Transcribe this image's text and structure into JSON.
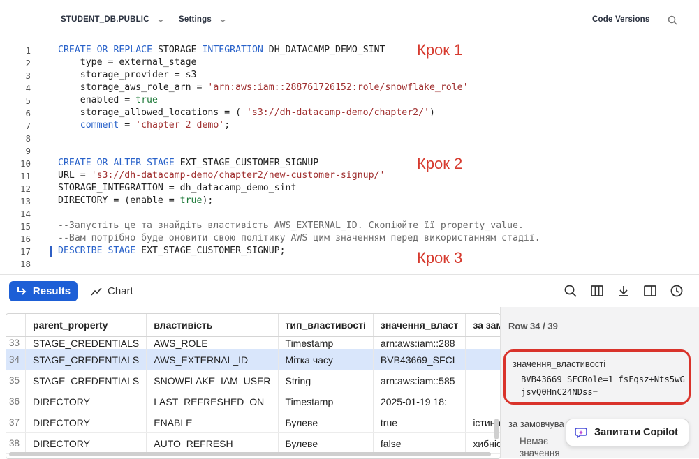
{
  "topbar": {
    "database": "STUDENT_DB.PUBLIC",
    "settings": "Settings",
    "code_versions": "Code Versions"
  },
  "editor": {
    "line_numbers": [
      "1",
      "2",
      "3",
      "4",
      "5",
      "6",
      "7",
      "8",
      "9",
      "10",
      "11",
      "12",
      "13",
      "14",
      "15",
      "16",
      "17",
      "18"
    ],
    "steps": [
      "Крок 1",
      "Крок 2",
      "Крок 3"
    ]
  },
  "results": {
    "results_tab": "Results",
    "chart_tab": "Chart",
    "columns": [
      "parent_property",
      "властивість",
      "тип_властивості",
      "значення_власт",
      "за замов"
    ],
    "rows": [
      {
        "idx": "33",
        "parent": "STAGE_CREDENTIALS",
        "prop": "AWS_ROLE",
        "type": "Timestamp",
        "value": "arn:aws:iam::288",
        "default": ""
      },
      {
        "idx": "34",
        "parent": "STAGE_CREDENTIALS",
        "prop": "AWS_EXTERNAL_ID",
        "type": "Мітка часу",
        "value": "BVB43669_SFCI",
        "default": ""
      },
      {
        "idx": "35",
        "parent": "STAGE_CREDENTIALS",
        "prop": "SNOWFLAKE_IAM_USER",
        "type": "String",
        "value": "arn:aws:iam::585",
        "default": ""
      },
      {
        "idx": "36",
        "parent": "DIRECTORY",
        "prop": "LAST_REFRESHED_ON",
        "type": "Timestamp",
        "value": "2025-01-19 18:",
        "default": ""
      },
      {
        "idx": "37",
        "parent": "DIRECTORY",
        "prop": "ENABLE",
        "type": "Булеве",
        "value": "true",
        "default": "істина"
      },
      {
        "idx": "38",
        "parent": "DIRECTORY",
        "prop": "AUTO_REFRESH",
        "type": "Булеве",
        "value": "false",
        "default": "хибність"
      }
    ]
  },
  "panel": {
    "row_count": "Row 34 / 39",
    "prop_label": "значення_властивості",
    "prop_value": "BVB43669_SFCRole=1_fsFqsz+Nts5wGjsvQ0HnC24NDss=",
    "default_label": "за замовчува",
    "no_value": "Немає значення"
  },
  "copilot": {
    "label": "Запитати Copilot"
  }
}
